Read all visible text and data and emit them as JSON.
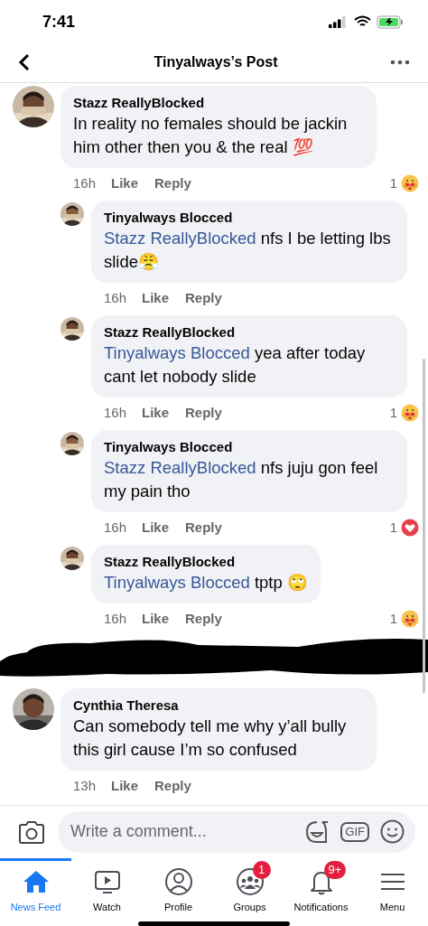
{
  "status_bar": {
    "time": "7:41"
  },
  "header": {
    "title": "Tinyalways’s Post"
  },
  "comments": [
    {
      "kind": "comment",
      "author": "Stazz ReallyBlocked",
      "text": "In reality no females should be jackin him other then you & the real 💯",
      "time": "16h",
      "like": "Like",
      "reply": "Reply",
      "reaction": {
        "count": "1",
        "kind": "care"
      },
      "replies": [
        {
          "author": "Tinyalways Blocced",
          "mention": "Stazz ReallyBlocked",
          "text": "nfs I be letting lbs slide😤",
          "time": "16h",
          "like": "Like",
          "reply": "Reply"
        },
        {
          "author": "Stazz ReallyBlocked",
          "mention": "Tinyalways Blocced",
          "text": " yea after today cant let nobody slide",
          "time": "16h",
          "like": "Like",
          "reply": "Reply",
          "reaction": {
            "count": "1",
            "kind": "care"
          }
        },
        {
          "author": "Tinyalways Blocced",
          "mention": "Stazz ReallyBlocked",
          "text": "nfs juju gon feel my pain tho",
          "time": "16h",
          "like": "Like",
          "reply": "Reply",
          "reaction": {
            "count": "1",
            "kind": "love"
          }
        },
        {
          "author": "Stazz ReallyBlocked",
          "mention": "Tinyalways Blocced",
          "text": " tptp 🙄",
          "time": "16h",
          "like": "Like",
          "reply": "Reply",
          "reaction": {
            "count": "1",
            "kind": "care"
          }
        }
      ]
    },
    {
      "kind": "redacted"
    },
    {
      "kind": "comment",
      "author": "Cynthia Theresa",
      "text": "Can somebody tell me why y’all bully this girl cause I’m so confused",
      "time": "13h",
      "like": "Like",
      "reply": "Reply"
    }
  ],
  "composer": {
    "placeholder": "Write a comment...",
    "gif": "GIF"
  },
  "tabs": [
    {
      "label": "News Feed",
      "kind": "home",
      "selected": true
    },
    {
      "label": "Watch",
      "kind": "watch",
      "selected": false
    },
    {
      "label": "Profile",
      "kind": "profile",
      "selected": false
    },
    {
      "label": "Groups",
      "kind": "groups",
      "selected": false,
      "badge": "1"
    },
    {
      "label": "Notifications",
      "kind": "bell",
      "selected": false,
      "badge": "9+"
    },
    {
      "label": "Menu",
      "kind": "menu",
      "selected": false
    }
  ]
}
